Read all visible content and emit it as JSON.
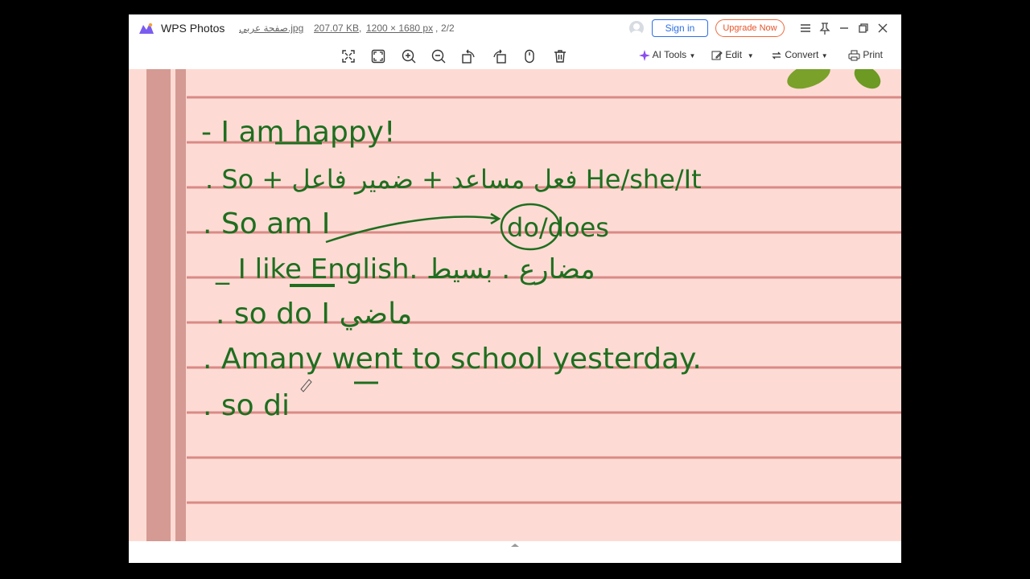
{
  "app": {
    "name": "WPS Photos",
    "file_name": "صفحة عربي.jpg",
    "file_size": "207.07 KB",
    "dimensions": "1200 × 1680 px",
    "page_counter": "2/2"
  },
  "titlebar": {
    "sign_in": "Sign in",
    "upgrade": "Upgrade Now"
  },
  "toolbar": {
    "ai_tools": "AI Tools",
    "edit": "Edit",
    "convert": "Convert",
    "print": "Print",
    "icons": [
      "fullscreen-icon",
      "fit-window-icon",
      "zoom-in-icon",
      "zoom-out-icon",
      "rotate-left-icon",
      "rotate-right-icon",
      "mouse-icon",
      "delete-icon"
    ]
  },
  "notes": {
    "lines": [
      "- I am happy!",
      ". So + فعل مساعد + ضمير فاعل    He/she/It",
      ". So am I",
      "do/does",
      "_ I like English. مضارع . بسيط",
      ". so do I ماضي",
      ". Amany went to school yesterday.",
      ". so di"
    ]
  },
  "colors": {
    "ink": "#1f6e1f",
    "paper": "#fddbd4",
    "rule": "#d98a86",
    "margin": "#d59a93",
    "accent": "#2f6fe4",
    "upgrade": "#e8552a"
  }
}
